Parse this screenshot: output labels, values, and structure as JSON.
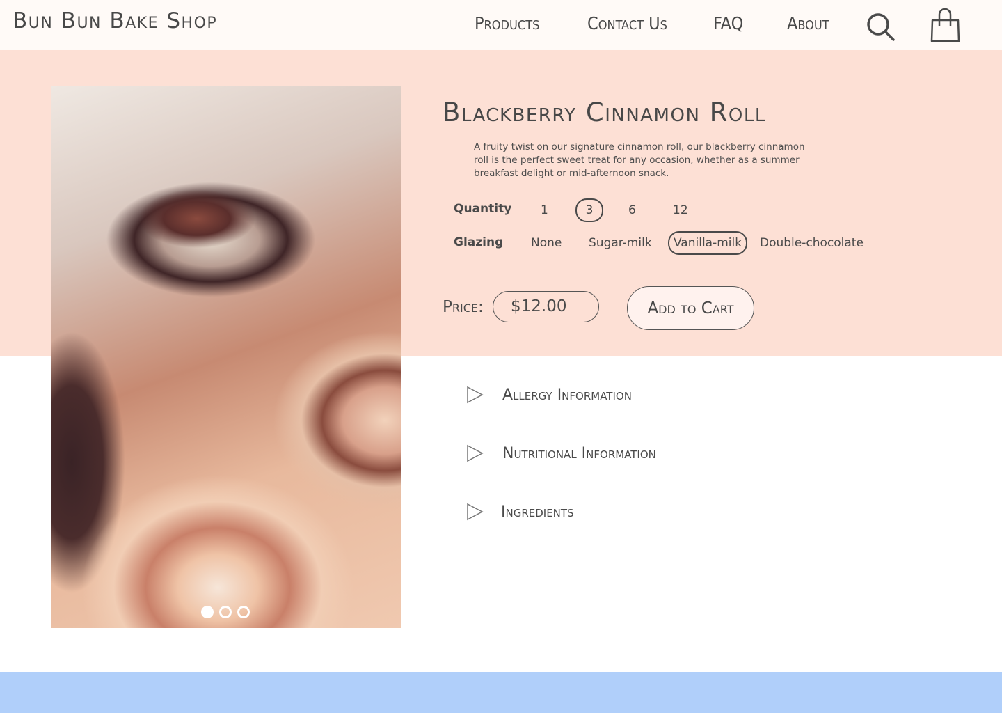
{
  "header": {
    "brand": "Bun Bun Bake Shop",
    "nav": [
      {
        "label": "Products"
      },
      {
        "label": "Contact Us"
      },
      {
        "label": "FAQ"
      },
      {
        "label": "About"
      }
    ],
    "icons": {
      "search": "search-icon",
      "cart": "shopping-bag-icon"
    }
  },
  "product": {
    "title": "Blackberry Cinnamon Roll",
    "description": "A fruity twist on our signature cinnamon roll, our blackberry cinnamon roll is the perfect sweet treat for any occasion, whether as a summer breakfast delight or mid-afternoon snack.",
    "image_alt": "Blackberry cinnamon rolls photo",
    "carousel": {
      "total": 3,
      "active_index": 0
    },
    "quantity": {
      "label": "Quantity",
      "options": [
        "1",
        "3",
        "6",
        "12"
      ],
      "selected": "3"
    },
    "glazing": {
      "label": "Glazing",
      "options": [
        "None",
        "Sugar-milk",
        "Vanilla-milk",
        "Double-chocolate"
      ],
      "selected": "Vanilla-milk"
    },
    "price_label": "Price:",
    "price_value": "$12.00",
    "add_to_cart_label": "Add to Cart"
  },
  "accordion": [
    {
      "label": "Allergy Information",
      "icon": "triangle-right-icon"
    },
    {
      "label": "Nutritional Information",
      "icon": "triangle-right-icon"
    },
    {
      "label": "Ingredients",
      "icon": "triangle-right-icon"
    }
  ],
  "colors": {
    "header_bg": "#fffaf7",
    "hero_bg": "#fde0d5",
    "footer_bg": "#b0cffa",
    "text": "#484848"
  }
}
